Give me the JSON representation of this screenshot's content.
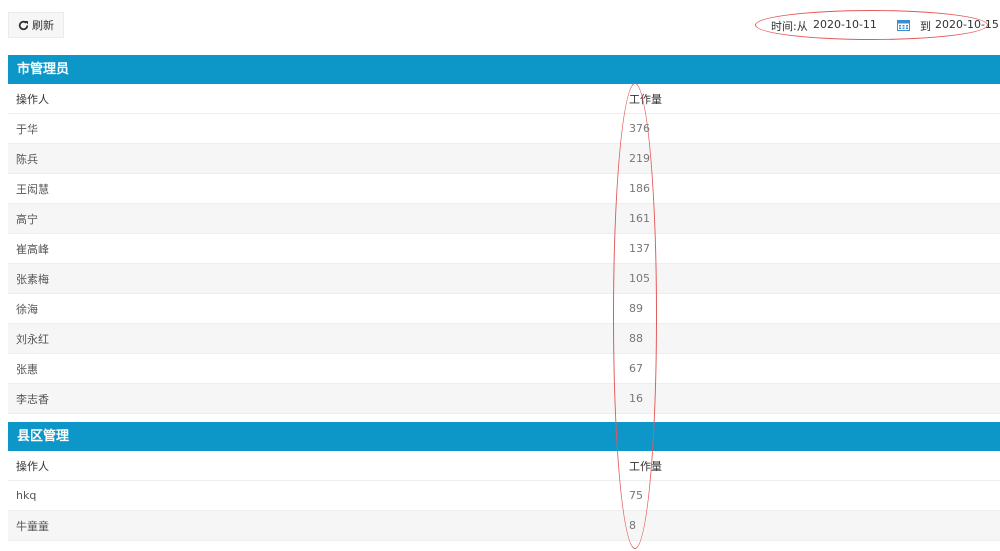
{
  "toolbar": {
    "refresh_label": "刷新",
    "refresh_icon": "refresh-icon"
  },
  "time_filter": {
    "from_label": "时间:从",
    "from_date": "2020-10-11",
    "to_label": "到",
    "to_date": "2020-10-15",
    "calendar_icon": "calendar-icon"
  },
  "colors": {
    "header_bg": "#0d96c8",
    "annotation": "#e35a5a"
  },
  "sections": [
    {
      "title": "市管理员",
      "columns": [
        "操作人",
        "工作量"
      ],
      "rows": [
        {
          "name": "于华",
          "count": "376"
        },
        {
          "name": "陈兵",
          "count": "219"
        },
        {
          "name": "王闳慧",
          "count": "186"
        },
        {
          "name": "高宁",
          "count": "161"
        },
        {
          "name": "崔高峰",
          "count": "137"
        },
        {
          "name": "张素梅",
          "count": "105"
        },
        {
          "name": "徐海",
          "count": "89"
        },
        {
          "name": "刘永红",
          "count": "88"
        },
        {
          "name": "张惠",
          "count": "67"
        },
        {
          "name": "李志香",
          "count": "16"
        }
      ]
    },
    {
      "title": "县区管理",
      "columns": [
        "操作人",
        "工作量"
      ],
      "rows": [
        {
          "name": "hkq",
          "count": "75"
        },
        {
          "name": "牛童童",
          "count": "8"
        }
      ]
    }
  ]
}
